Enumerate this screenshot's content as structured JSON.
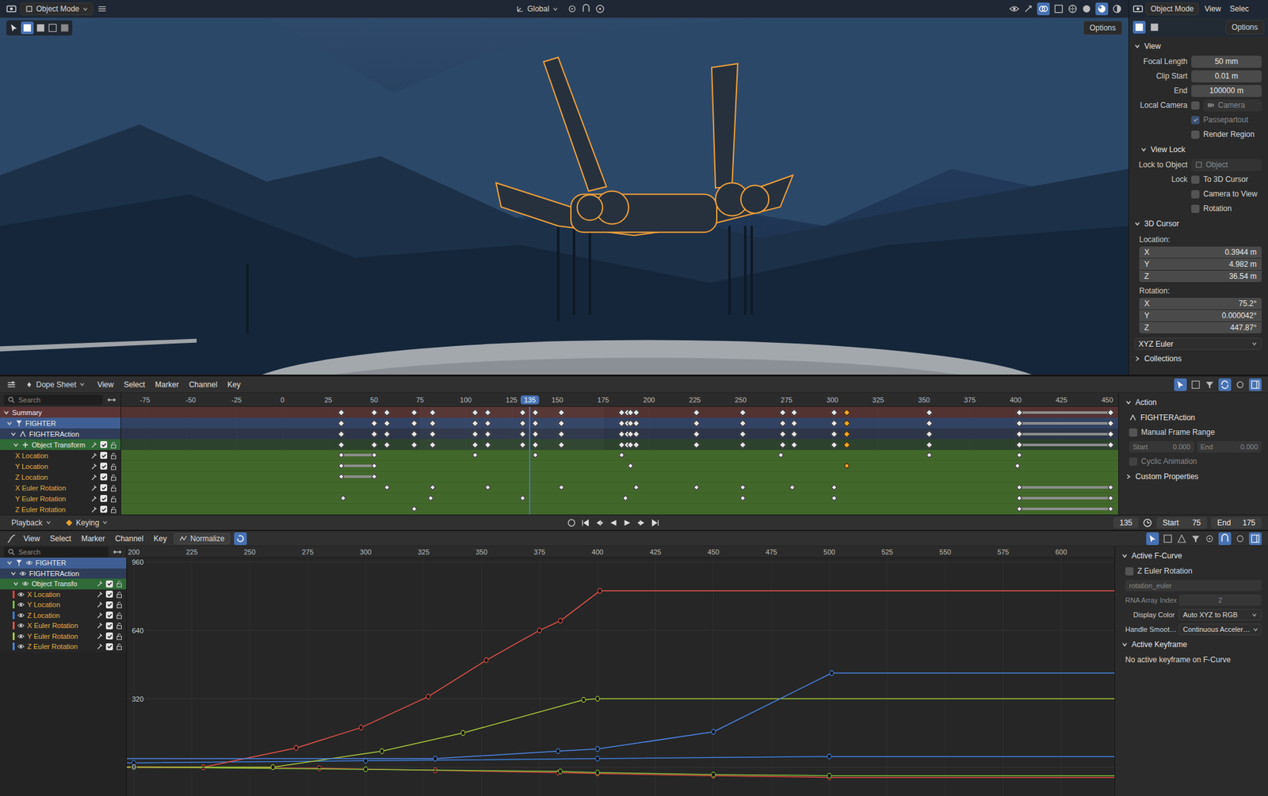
{
  "viewport": {
    "mode": "Object Mode",
    "orientation": "Global",
    "options": "Options"
  },
  "n_panel": {
    "mode": "Object Mode",
    "menus": [
      "View",
      "Selec"
    ],
    "options": "Options",
    "view": {
      "title": "View",
      "expanded": true,
      "fields": [
        {
          "label": "Focal Length",
          "value": "50 mm"
        },
        {
          "label": "Clip Start",
          "value": "0.01 m"
        },
        {
          "label": "End",
          "value": "100000 m"
        }
      ]
    },
    "local_camera": {
      "label": "Local Camera",
      "checked": false,
      "value": "Camera"
    },
    "toggles": [
      {
        "label": "Passepartout",
        "checked": true,
        "disabled": true
      },
      {
        "label": "Render Region",
        "checked": false,
        "disabled": false
      }
    ],
    "view_lock": {
      "title": "View Lock",
      "expanded": true,
      "object_label": "Lock to Object",
      "object_value": "Object",
      "lock_label": "Lock",
      "options": [
        {
          "label": "To 3D Cursor",
          "checked": false
        },
        {
          "label": "Camera to View",
          "checked": false
        },
        {
          "label": "Rotation",
          "checked": false
        }
      ]
    },
    "cursor": {
      "title": "3D Cursor",
      "expanded": true,
      "location_label": "Location:",
      "location": [
        {
          "axis": "X",
          "value": "0.3944 m"
        },
        {
          "axis": "Y",
          "value": "4.982 m"
        },
        {
          "axis": "Z",
          "value": "36.54 m"
        }
      ],
      "rotation_label": "Rotation:",
      "rotation": [
        {
          "axis": "X",
          "value": "75.2°"
        },
        {
          "axis": "Y",
          "value": "0.000042°"
        },
        {
          "axis": "Z",
          "value": "447.87°"
        }
      ],
      "mode": "XYZ Euler"
    },
    "collections": {
      "title": "Collections",
      "expanded": false
    }
  },
  "dope_sheet": {
    "editor": "Dope Sheet",
    "menus": [
      "View",
      "Select",
      "Marker",
      "Channel",
      "Key"
    ],
    "search_placeholder": "Search",
    "ticks": [
      "-75",
      "-50",
      "-25",
      "0",
      "25",
      "50",
      "75",
      "100",
      "125",
      "150",
      "175",
      "200",
      "225",
      "250",
      "275",
      "300",
      "325",
      "350",
      "375",
      "400",
      "425",
      "450"
    ],
    "channels": [
      {
        "name": "Summary",
        "kind": "summary",
        "expanded": true,
        "keys": [
          32,
          50,
          57,
          72,
          82,
          105,
          112,
          131,
          138,
          152,
          185,
          188,
          190,
          193,
          226,
          251,
          273,
          279,
          301,
          308,
          353,
          402,
          452
        ],
        "selected_keys": [
          308
        ],
        "holds": [
          [
            402,
            452
          ]
        ]
      },
      {
        "name": "FIGHTER",
        "kind": "object",
        "expanded": true,
        "keys": [
          32,
          50,
          57,
          72,
          82,
          105,
          112,
          131,
          138,
          152,
          185,
          188,
          190,
          193,
          226,
          251,
          273,
          279,
          301,
          308,
          353,
          402,
          452
        ],
        "selected_keys": [
          308
        ],
        "holds": [
          [
            402,
            452
          ]
        ]
      },
      {
        "name": "FIGHTERAction",
        "kind": "action",
        "expanded": true,
        "keys": [
          32,
          50,
          57,
          72,
          82,
          105,
          112,
          131,
          138,
          152,
          185,
          188,
          190,
          193,
          226,
          251,
          273,
          279,
          301,
          308,
          353,
          402,
          452
        ],
        "selected_keys": [
          308
        ],
        "holds": [
          [
            402,
            452
          ]
        ]
      },
      {
        "name": "Object Transform",
        "kind": "group",
        "expanded": true,
        "enabled": true,
        "locked": false,
        "keys": [
          32,
          50,
          57,
          72,
          82,
          105,
          112,
          131,
          138,
          152,
          185,
          188,
          190,
          193,
          226,
          251,
          273,
          279,
          301,
          308,
          353,
          402,
          452
        ],
        "selected_keys": [
          308
        ],
        "holds": [
          [
            402,
            452
          ]
        ]
      },
      {
        "name": "X Location",
        "kind": "fcurve",
        "selected": true,
        "enabled": true,
        "locked": false,
        "keys": [
          32,
          50,
          105,
          138,
          185,
          272,
          353,
          402
        ],
        "selected_keys": [],
        "holds": [
          [
            32,
            50
          ]
        ]
      },
      {
        "name": "Y Location",
        "kind": "fcurve",
        "selected": true,
        "enabled": true,
        "locked": false,
        "keys": [
          32,
          50,
          190,
          308,
          401
        ],
        "selected_keys": [
          308
        ],
        "holds": [
          [
            32,
            50
          ]
        ]
      },
      {
        "name": "Z Location",
        "kind": "fcurve",
        "selected": true,
        "enabled": true,
        "locked": false,
        "keys": [
          32,
          50
        ],
        "selected_keys": [],
        "holds": [
          [
            32,
            50
          ]
        ]
      },
      {
        "name": "X Euler Rotation",
        "kind": "fcurve",
        "selected": true,
        "enabled": true,
        "locked": false,
        "keys": [
          57,
          82,
          112,
          152,
          193,
          226,
          251,
          278,
          301,
          402,
          452
        ],
        "selected_keys": [],
        "holds": [
          [
            402,
            452
          ]
        ]
      },
      {
        "name": "Y Euler Rotation",
        "kind": "fcurve",
        "selected": true,
        "enabled": true,
        "locked": false,
        "keys": [
          33,
          81,
          131,
          187,
          251,
          301,
          402,
          452
        ],
        "selected_keys": [],
        "holds": [
          [
            402,
            452
          ]
        ]
      },
      {
        "name": "Z Euler Rotation",
        "kind": "fcurve",
        "selected": true,
        "enabled": true,
        "locked": false,
        "keys": [
          72,
          402,
          452
        ],
        "selected_keys": [],
        "holds": [
          [
            402,
            452
          ]
        ]
      }
    ],
    "sidebar": {
      "title": "Action",
      "expanded": true,
      "action": "FIGHTERAction",
      "manual_range": {
        "label": "Manual Frame Range",
        "checked": false
      },
      "start": {
        "label": "Start",
        "value": "0.000",
        "disabled": true
      },
      "end": {
        "label": "End",
        "value": "0.000",
        "disabled": true
      },
      "cyclic": {
        "label": "Cyclic Animation",
        "checked": false,
        "disabled": true
      },
      "custom_properties": {
        "title": "Custom Properties",
        "expanded": false
      }
    }
  },
  "playback": {
    "menus": [
      "Playback",
      "Keying"
    ],
    "frame": "135",
    "start_label": "Start",
    "start": "75",
    "end_label": "End",
    "end": "175"
  },
  "graph_editor": {
    "menus": [
      "View",
      "Select",
      "Marker",
      "Channel",
      "Key"
    ],
    "normalize": {
      "label": "Normalize",
      "checked": false
    },
    "search_placeholder": "Search",
    "ticks": [
      "200",
      "225",
      "250",
      "275",
      "300",
      "325",
      "350",
      "375",
      "400",
      "425",
      "450",
      "475",
      "500",
      "525",
      "550",
      "575",
      "600"
    ],
    "value_ticks": [
      "960",
      "640",
      "320",
      "0"
    ],
    "channels": [
      {
        "name": "FIGHTER",
        "kind": "object",
        "expanded": true,
        "visible": true
      },
      {
        "name": "FIGHTERAction",
        "kind": "action",
        "expanded": true,
        "visible": true
      },
      {
        "name": "Object Transfo",
        "kind": "group",
        "expanded": true,
        "visible": true,
        "enabled": true,
        "locked": false
      },
      {
        "name": "X Location",
        "kind": "fcurve",
        "visible": true,
        "enabled": true,
        "locked": false,
        "color": "#e0453d",
        "frames": [
          200,
          280,
          330,
          383,
          400,
          450,
          500
        ],
        "values": [
          0,
          -5,
          -15,
          -25,
          -30,
          -40,
          -48
        ]
      },
      {
        "name": "Y Location",
        "kind": "fcurve",
        "visible": true,
        "enabled": true,
        "locked": false,
        "color": "#7fbf3a",
        "frames": [
          200,
          300,
          384,
          400,
          450,
          500
        ],
        "values": [
          0,
          -10,
          -20,
          -25,
          -35,
          -40
        ]
      },
      {
        "name": "Z Location",
        "kind": "fcurve",
        "visible": true,
        "enabled": true,
        "locked": false,
        "color": "#3d7fe0",
        "frames": [
          200,
          300,
          400,
          500
        ],
        "values": [
          20,
          30,
          40,
          50
        ]
      },
      {
        "name": "X Euler Rotation",
        "kind": "fcurve",
        "visible": true,
        "enabled": true,
        "locked": false,
        "color": "#e8524a",
        "frames": [
          230,
          270,
          298,
          327,
          352,
          375,
          384,
          401
        ],
        "values": [
          0,
          90,
          185,
          330,
          500,
          640,
          685,
          825
        ]
      },
      {
        "name": "Y Euler Rotation",
        "kind": "fcurve",
        "visible": true,
        "enabled": true,
        "locked": false,
        "color": "#a8c83a",
        "frames": [
          260,
          307,
          342,
          394,
          400
        ],
        "values": [
          0,
          75,
          160,
          315,
          320
        ]
      },
      {
        "name": "Z Euler Rotation",
        "kind": "fcurve",
        "visible": true,
        "enabled": true,
        "locked": false,
        "color": "#4a86e8",
        "frames": [
          330,
          383,
          400,
          450,
          501
        ],
        "values": [
          40,
          75,
          85,
          165,
          440
        ]
      }
    ],
    "sidebar": {
      "title": "Active F-Curve",
      "expanded": true,
      "curve": "Z Euler Rotation",
      "curve_checked": false,
      "path": "rotation_euler",
      "rna_label": "RNA Array Index",
      "rna_value": "2",
      "display_color_label": "Display Color",
      "display_color": "Auto XYZ to RGB",
      "handle_label": "Handle Smoot…",
      "handle_value": "Continuous Acceler…",
      "keyframe_title": "Active Keyframe",
      "keyframe_expanded": true,
      "keyframe_text": "No active keyframe on F-Curve"
    }
  }
}
